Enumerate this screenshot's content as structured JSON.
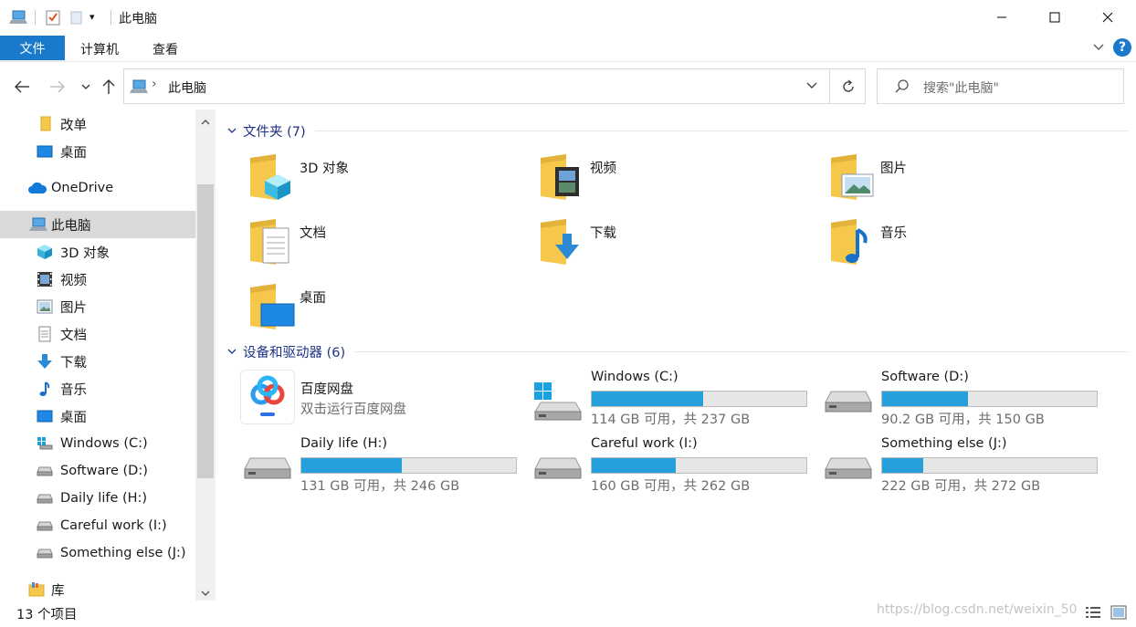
{
  "window": {
    "title": "此电脑",
    "dropdown_glyph": "▾"
  },
  "ribbon": {
    "tabs": [
      "文件",
      "计算机",
      "查看"
    ],
    "help": "?"
  },
  "address": {
    "path": "此电脑",
    "separator": "›"
  },
  "search": {
    "placeholder": "搜索\"此电脑\""
  },
  "nav": {
    "items": [
      {
        "label": "改单",
        "icon": "folder-icon"
      },
      {
        "label": "桌面",
        "icon": "desktop-icon"
      },
      {
        "label": "OneDrive",
        "icon": "cloud-icon"
      },
      {
        "label": "此电脑",
        "icon": "computer-icon"
      },
      {
        "label": "3D 对象",
        "icon": "cube-icon"
      },
      {
        "label": "视频",
        "icon": "film-icon"
      },
      {
        "label": "图片",
        "icon": "picture-icon"
      },
      {
        "label": "文档",
        "icon": "document-icon"
      },
      {
        "label": "下载",
        "icon": "download-arrow-icon"
      },
      {
        "label": "音乐",
        "icon": "music-note-icon"
      },
      {
        "label": "桌面",
        "icon": "desktop-icon"
      },
      {
        "label": "Windows (C:)",
        "icon": "windows-drive-icon"
      },
      {
        "label": "Software (D:)",
        "icon": "drive-icon"
      },
      {
        "label": "Daily life (H:)",
        "icon": "drive-icon"
      },
      {
        "label": "Careful work (I:)",
        "icon": "drive-icon"
      },
      {
        "label": "Something else (J:)",
        "icon": "drive-icon"
      },
      {
        "label": "库",
        "icon": "library-icon"
      }
    ]
  },
  "folders": {
    "header": "文件夹 (7)",
    "items": [
      {
        "label": "3D 对象",
        "icon": "cube-icon"
      },
      {
        "label": "视频",
        "icon": "film-icon"
      },
      {
        "label": "图片",
        "icon": "picture-icon"
      },
      {
        "label": "文档",
        "icon": "document-icon"
      },
      {
        "label": "下载",
        "icon": "download-arrow-icon"
      },
      {
        "label": "音乐",
        "icon": "music-note-icon"
      },
      {
        "label": "桌面",
        "icon": "desktop-icon"
      }
    ]
  },
  "devices": {
    "header": "设备和驱动器 (6)",
    "baidu": {
      "name": "百度网盘",
      "subtitle": "双击运行百度网盘"
    },
    "drives": [
      {
        "name": "Windows (C:)",
        "size": "114 GB 可用，共 237 GB",
        "used_fraction": 0.52,
        "icon": "windows-drive-icon"
      },
      {
        "name": "Software (D:)",
        "size": "90.2 GB 可用，共 150 GB",
        "used_fraction": 0.4,
        "icon": "drive-icon"
      },
      {
        "name": "Daily life (H:)",
        "size": "131 GB 可用，共 246 GB",
        "used_fraction": 0.47,
        "icon": "drive-icon"
      },
      {
        "name": "Careful work (I:)",
        "size": "160 GB 可用，共 262 GB",
        "used_fraction": 0.39,
        "icon": "drive-icon"
      },
      {
        "name": "Something else (J:)",
        "size": "222 GB 可用，共 272 GB",
        "used_fraction": 0.19,
        "icon": "drive-icon"
      }
    ]
  },
  "status": {
    "count": "13 个项目",
    "watermark": "https://blog.csdn.net/weixin_50"
  },
  "colors": {
    "accent": "#1979ca",
    "bar_fill": "#26a0da",
    "group_header": "#1e3287",
    "folder_yellow": "#f5c84c"
  }
}
